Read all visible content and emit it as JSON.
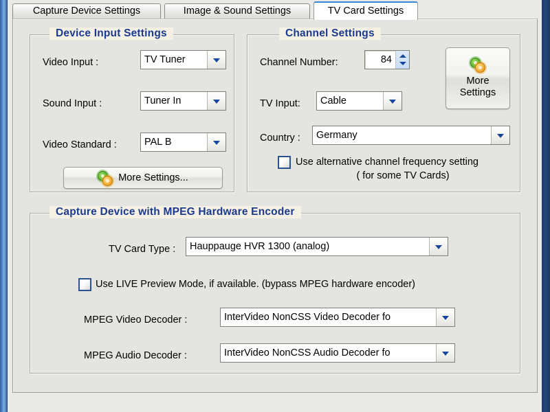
{
  "window": {
    "chrome_color": "#2f5f9e"
  },
  "tabs": [
    {
      "label": "Capture Device Settings",
      "active": false
    },
    {
      "label": "Image & Sound Settings",
      "active": false
    },
    {
      "label": "TV Card Settings",
      "active": true
    }
  ],
  "device_input": {
    "title": "Device Input Settings",
    "video_input_label": "Video Input :",
    "video_input_value": "TV Tuner",
    "sound_input_label": "Sound Input :",
    "sound_input_value": "Tuner In",
    "video_standard_label": "Video Standard :",
    "video_standard_value": "PAL B",
    "more_settings_button": "More Settings..."
  },
  "channel": {
    "title": "Channel Settings",
    "channel_number_label": "Channel Number:",
    "channel_number_value": "84",
    "tv_input_label": "TV Input:",
    "tv_input_value": "Cable",
    "country_label": "Country :",
    "country_value": "Germany",
    "more_settings_line1": "More",
    "more_settings_line2": "Settings",
    "alt_freq_line1": "Use alternative channel frequency setting",
    "alt_freq_line2": "( for some TV Cards)",
    "alt_freq_checked": false
  },
  "mpeg": {
    "title": "Capture Device with MPEG Hardware Encoder",
    "tv_card_type_label": "TV Card Type :",
    "tv_card_type_value": "Hauppauge HVR 1300 (analog)",
    "live_preview_label": "Use LIVE Preview Mode, if available. (bypass MPEG hardware encoder)",
    "live_preview_checked": false,
    "video_decoder_label": "MPEG Video Decoder :",
    "video_decoder_value": "InterVideo NonCSS Video Decoder fo",
    "audio_decoder_label": "MPEG Audio Decoder :",
    "audio_decoder_value": "InterVideo NonCSS Audio Decoder fo"
  },
  "icons": {
    "gears": "gears-icon",
    "dropdown": "chevron-down-icon",
    "spinner": "spinner-updown-icon"
  }
}
